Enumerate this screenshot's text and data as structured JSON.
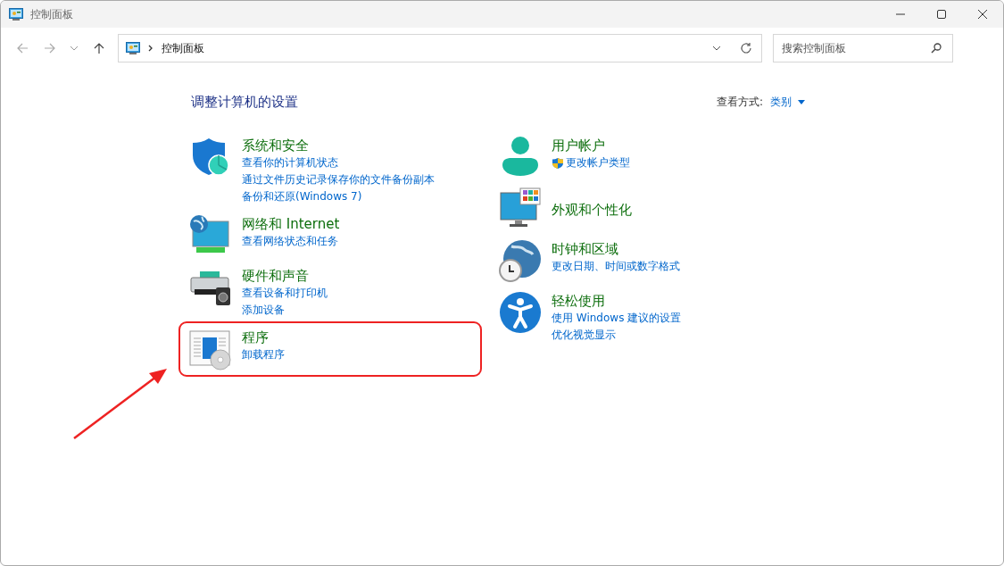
{
  "window": {
    "title": "控制面板"
  },
  "address_bar": {
    "path": "控制面板"
  },
  "search": {
    "placeholder": "搜索控制面板"
  },
  "heading": "调整计算机的设置",
  "view_by": {
    "label": "查看方式:",
    "value": "类别"
  },
  "columns": [
    {
      "categories": [
        {
          "kind": "security",
          "title": "系统和安全",
          "highlighted": false,
          "links": [
            {
              "text": "查看你的计算机状态",
              "shield": false
            },
            {
              "text": "通过文件历史记录保存你的文件备份副本",
              "shield": false
            },
            {
              "text": "备份和还原(Windows 7)",
              "shield": false
            }
          ]
        },
        {
          "kind": "network",
          "title": "网络和 Internet",
          "highlighted": false,
          "links": [
            {
              "text": "查看网络状态和任务",
              "shield": false
            }
          ]
        },
        {
          "kind": "hardware",
          "title": "硬件和声音",
          "highlighted": false,
          "links": [
            {
              "text": "查看设备和打印机",
              "shield": false
            },
            {
              "text": "添加设备",
              "shield": false
            }
          ]
        },
        {
          "kind": "programs",
          "title": "程序",
          "highlighted": true,
          "links": [
            {
              "text": "卸载程序",
              "shield": false
            }
          ]
        }
      ]
    },
    {
      "categories": [
        {
          "kind": "user",
          "title": "用户帐户",
          "highlighted": false,
          "links": [
            {
              "text": "更改帐户类型",
              "shield": true
            }
          ]
        },
        {
          "kind": "appearance",
          "title": "外观和个性化",
          "highlighted": false
        },
        {
          "kind": "clock",
          "title": "时钟和区域",
          "highlighted": false,
          "links": [
            {
              "text": "更改日期、时间或数字格式",
              "shield": false
            }
          ]
        },
        {
          "kind": "access",
          "title": "轻松使用",
          "highlighted": false,
          "links": [
            {
              "text": "使用 Windows 建议的设置",
              "shield": false
            },
            {
              "text": "优化视觉显示",
              "shield": false
            }
          ]
        }
      ]
    }
  ]
}
